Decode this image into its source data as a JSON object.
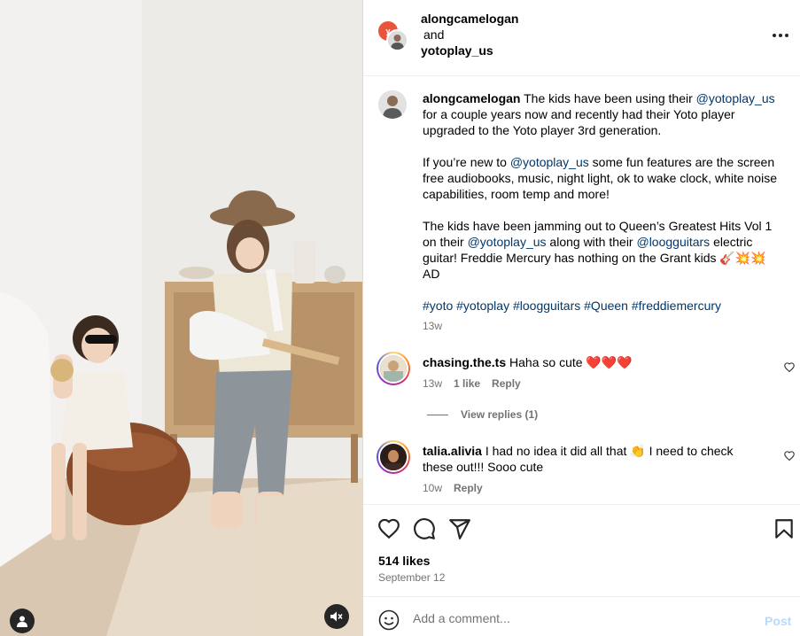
{
  "post": {
    "authors": [
      "alongcamelogan",
      "yotoplay_us"
    ],
    "and_text": "and",
    "brand_avatar_text": "y",
    "more_icon": "more-horizontal-icon"
  },
  "caption": {
    "username": "alongcamelogan",
    "p1_text1": " The kids have been using their ",
    "p1_mention": "@yotoplay_us",
    "p1_text2": " for a couple years now and recently had their Yoto player upgraded to the Yoto player 3rd generation.",
    "p2_text1": "If you’re new to ",
    "p2_mention": "@yotoplay_us",
    "p2_text2": " some fun features are the screen free audiobooks, music, night light, ok to wake clock, white noise capabilities, room temp and more!",
    "p3_text1": "The kids have been jamming out to Queen’s Greatest Hits Vol 1 on their ",
    "p3_mention1": "@yotoplay_us",
    "p3_text2": " along with their ",
    "p3_mention2": "@loogguitars",
    "p3_text3": " electric guitar! Freddie Mercury has nothing on the Grant kids 🎸💥💥",
    "p3_ad": "AD",
    "hashtags": [
      "#yoto",
      "#yotoplay",
      "#loogguitars",
      "#Queen",
      "#freddiemercury"
    ],
    "age": "13w"
  },
  "comments": [
    {
      "username": "chasing.the.ts",
      "text": " Haha so cute ❤️❤️❤️",
      "age": "13w",
      "likes": "1 like",
      "reply": "Reply"
    },
    {
      "username": "talia.alivia",
      "text": " I had no idea it did all that 👏 I need to check these out!!! Sooo cute",
      "age": "10w",
      "reply": "Reply"
    }
  ],
  "view_replies": "View replies (1)",
  "actions": {
    "like_icon": "heart-icon",
    "comment_icon": "comment-icon",
    "share_icon": "paper-plane-icon",
    "save_icon": "bookmark-icon"
  },
  "likes_count": "514 likes",
  "post_date": "September 12",
  "comment_box": {
    "placeholder": "Add a comment...",
    "post_label": "Post"
  },
  "colors": {
    "link": "#00376b",
    "muted": "#737373",
    "post_button": "#b3dbff",
    "brand_avatar": "#e8553d"
  }
}
